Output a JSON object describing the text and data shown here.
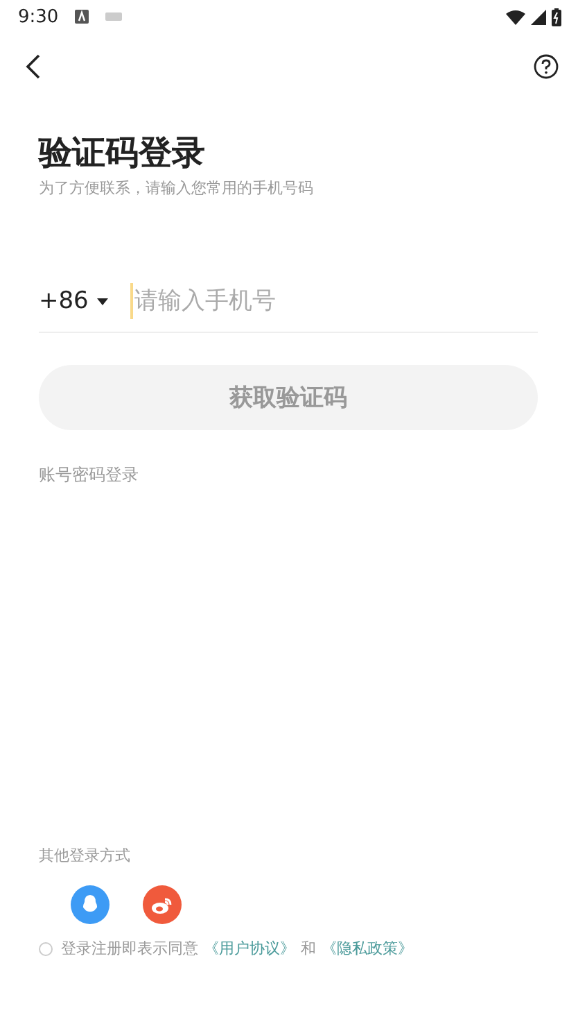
{
  "status_bar": {
    "time": "9:30"
  },
  "title": "验证码登录",
  "subtitle": "为了方便联系，请输入您常用的手机号码",
  "phone": {
    "country_code": "+86",
    "placeholder": "请输入手机号"
  },
  "submit": {
    "label": "获取验证码",
    "disabled": true
  },
  "password_login": "账号密码登录",
  "other_login": {
    "label": "其他登录方式",
    "methods": [
      {
        "kind": "qq",
        "color": "#3d9bf5"
      },
      {
        "kind": "weibo",
        "color": "#f05a3c"
      }
    ]
  },
  "agreement": {
    "checked": false,
    "text": "登录注册即表示同意",
    "link_1": "《用户协议》",
    "conjunction": "和",
    "link_2": "《隐私政策》"
  }
}
